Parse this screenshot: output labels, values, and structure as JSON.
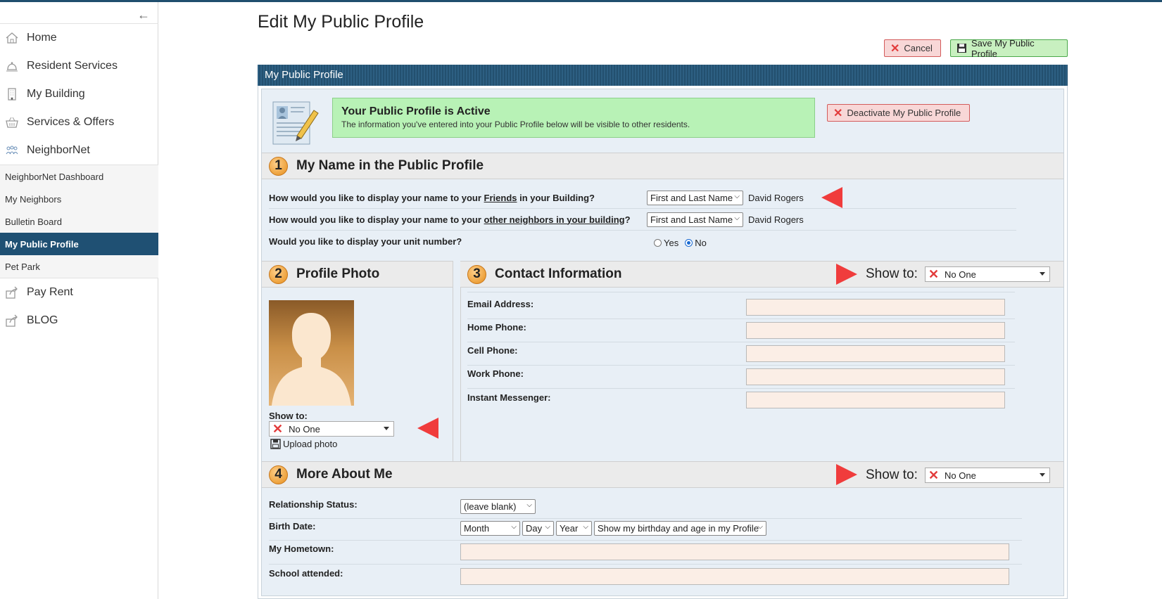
{
  "sidebar": {
    "main_items": [
      {
        "label": "Home",
        "icon": "home-icon"
      },
      {
        "label": "Resident Services",
        "icon": "bell-icon"
      },
      {
        "label": "My Building",
        "icon": "building-icon"
      },
      {
        "label": "Services & Offers",
        "icon": "basket-icon"
      },
      {
        "label": "NeighborNet",
        "icon": "people-icon"
      }
    ],
    "sub_items": [
      {
        "label": "NeighborNet Dashboard"
      },
      {
        "label": "My Neighbors"
      },
      {
        "label": "Bulletin Board"
      },
      {
        "label": "My Public Profile",
        "active": true
      },
      {
        "label": "Pet Park"
      }
    ],
    "bottom_items": [
      {
        "label": "Pay Rent",
        "icon": "share-icon"
      },
      {
        "label": "BLOG",
        "icon": "share-icon"
      }
    ]
  },
  "page": {
    "title": "Edit My Public Profile",
    "cancel_label": "Cancel",
    "save_label": "Save My Public Profile",
    "panel_title": "My Public Profile"
  },
  "banner": {
    "title": "Your Public Profile is Active",
    "text": "The information you've entered into your Public Profile below will be visible to other residents.",
    "deactivate_label": "Deactivate My Public Profile"
  },
  "section1": {
    "number": "1",
    "title": "My Name in the Public Profile",
    "q1_pre": "How would you like to display your name to your ",
    "q1_link": "Friends",
    "q1_post": " in your Building?",
    "q1_select": "First and Last Name",
    "q1_value": "David Rogers",
    "q2_pre": "How would you like to display your name to your ",
    "q2_link": "other neighbors in your building",
    "q2_post": "?",
    "q2_select": "First and Last Name",
    "q2_value": "David Rogers",
    "q3": "Would you like to display your unit number?",
    "yes_label": "Yes",
    "no_label": "No",
    "unit_selected": "No"
  },
  "section2": {
    "number": "2",
    "title": "Profile Photo",
    "show_to_label": "Show to:",
    "show_to_value": "No One",
    "upload_label": "Upload photo"
  },
  "section3": {
    "number": "3",
    "title": "Contact Information",
    "show_to_label": "Show to:",
    "show_to_value": "No One",
    "fields": [
      {
        "label": "Email Address:",
        "value": ""
      },
      {
        "label": "Home Phone:",
        "value": ""
      },
      {
        "label": "Cell Phone:",
        "value": ""
      },
      {
        "label": "Work Phone:",
        "value": ""
      },
      {
        "label": "Instant Messenger:",
        "value": ""
      }
    ]
  },
  "section4": {
    "number": "4",
    "title": "More About Me",
    "show_to_label": "Show to:",
    "show_to_value": "No One",
    "relationship_label": "Relationship Status:",
    "relationship_value": "(leave blank)",
    "birth_label": "Birth Date:",
    "birth_month": "Month",
    "birth_day": "Day",
    "birth_year": "Year",
    "birth_display": "Show my birthday and age in my Profile",
    "hometown_label": "My Hometown:",
    "school_label": "School attended:"
  },
  "colors": {
    "nav_active": "#1f5073",
    "panel_header": "#2d5f82",
    "banner_bg": "#b8f2b6",
    "input_bg": "#fbeee6",
    "arrow": "#f03c3c"
  }
}
